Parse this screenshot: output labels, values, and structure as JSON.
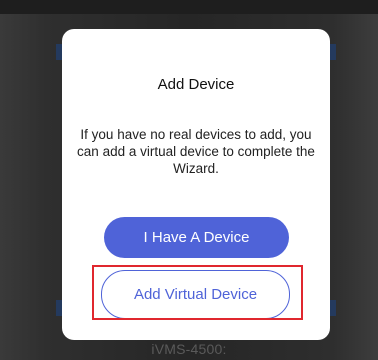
{
  "dialog": {
    "title": "Add Device",
    "message": "If you have no real devices to add, you can add a virtual device to complete the Wizard.",
    "primary_button": "I Have A Device",
    "secondary_button": "Add Virtual Device"
  },
  "background": {
    "caption": "iVMS-4500:"
  },
  "colors": {
    "accent": "#4f63d8",
    "highlight": "#e0272e",
    "overlay": "#2b2b2b"
  }
}
